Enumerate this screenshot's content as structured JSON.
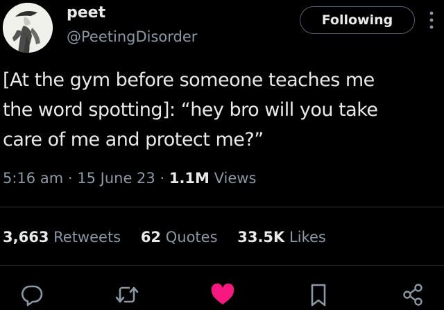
{
  "user": {
    "display_name": "peet",
    "handle": "@PeetingDisorder",
    "follow_label": "Following"
  },
  "tweet": {
    "text": "[At the gym before someone teaches me\nthe word spotting]: “hey bro will you take\ncare of me and protect me?”"
  },
  "meta": {
    "time": "5:16 am",
    "separator": "·",
    "date": "15 June 23",
    "views_count": "1.1M",
    "views_label": "Views"
  },
  "stats": {
    "retweets_count": "3,663",
    "retweets_label": "Retweets",
    "quotes_count": "62",
    "quotes_label": "Quotes",
    "likes_count": "33.5K",
    "likes_label": "Likes"
  },
  "actions": {
    "icons": [
      "reply-icon",
      "retweet-icon",
      "like-icon",
      "bookmark-icon",
      "share-icon"
    ],
    "like_color": "#f91880"
  },
  "colors": {
    "background": "#000000",
    "text": "#e7e9ea",
    "secondary": "#8b98a5",
    "divider": "#2f3336"
  }
}
